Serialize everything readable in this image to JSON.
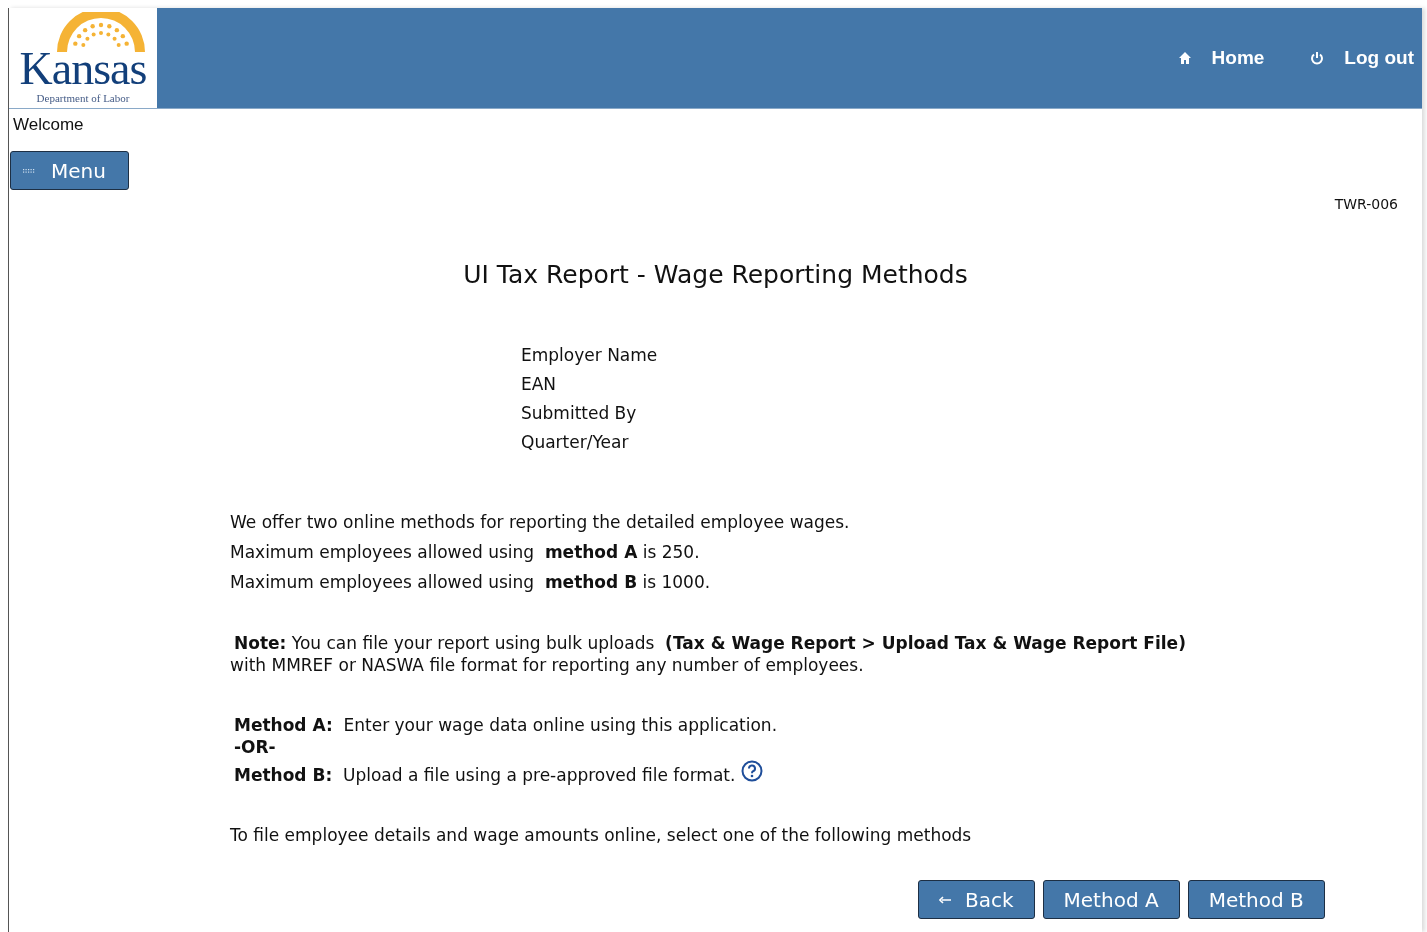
{
  "header": {
    "logo": {
      "name": "Kansas",
      "subtitle": "Department of Labor"
    },
    "nav": [
      {
        "kind": "home",
        "label": "Home"
      },
      {
        "kind": "power",
        "label": "Log out"
      }
    ]
  },
  "welcome": "Welcome",
  "menu_button": "Menu",
  "page_code": "TWR-006",
  "title": "UI Tax Report - Wage Reporting Methods",
  "info_fields": [
    "Employer Name",
    "EAN",
    "Submitted By",
    "Quarter/Year"
  ],
  "intro": [
    "We offer two online methods for reporting the detailed employee wages.",
    "Maximum employees allowed using  **method A** is 250.",
    "Maximum employees allowed using  **method B** is 1000."
  ],
  "note": [
    "**Note:** You can file your report using bulk uploads  **(Tax & Wage Report > Upload Tax & Wage Report File)**",
    "with MMREF or NASWA file format for reporting any number of employees."
  ],
  "methods": [
    {
      "kind": "method",
      "text": "**Method A:**  Enter your wage data online using this application.",
      "help": false
    },
    {
      "kind": "separator",
      "text": "-OR-"
    },
    {
      "kind": "method",
      "text": "**Method B:**  Upload a file using a pre-approved file format.",
      "help": true
    }
  ],
  "instruction": "To file employee details and wage amounts online, select one of the following methods",
  "buttons": [
    {
      "kind": "back",
      "label": "Back"
    },
    {
      "kind": "plain",
      "label": "Method A"
    },
    {
      "kind": "plain",
      "label": "Method B"
    }
  ]
}
